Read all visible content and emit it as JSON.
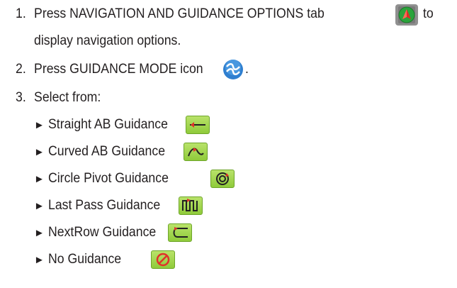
{
  "steps": [
    {
      "num": "1.",
      "before": "Press NAVIGATION AND GUIDANCE OPTIONS tab",
      "after": "to",
      "line2": "display navigation options.",
      "icon": "navigation-guidance-tab-icon"
    },
    {
      "num": "2.",
      "before": "Press GUIDANCE MODE icon",
      "after": ".",
      "icon": "guidance-mode-icon"
    },
    {
      "num": "3.",
      "text": "Select from:"
    }
  ],
  "options": [
    {
      "label": "Straight AB Guidance",
      "icon": "straight-ab-guidance-icon"
    },
    {
      "label": "Curved AB Guidance",
      "icon": "curved-ab-guidance-icon"
    },
    {
      "label": "Circle Pivot Guidance",
      "icon": "circle-pivot-guidance-icon"
    },
    {
      "label": "Last Pass Guidance",
      "icon": "last-pass-guidance-icon"
    },
    {
      "label": "NextRow Guidance",
      "icon": "nextrow-guidance-icon"
    },
    {
      "label": "No Guidance",
      "icon": "no-guidance-icon"
    }
  ],
  "bullet": "►",
  "colors": {
    "text": "#231f20",
    "button_green": "#9bd44a",
    "arrow_red": "#e0322a",
    "mode_blue": "#2f7fd0"
  }
}
